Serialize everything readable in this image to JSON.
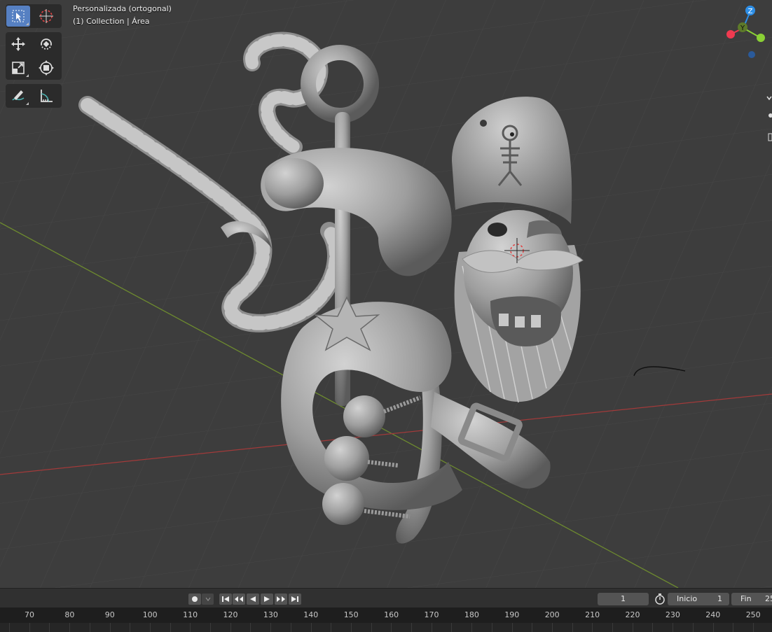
{
  "viewport": {
    "view_name": "Personalizada (ortogonal)",
    "collection_info": "(1) Collection | Área",
    "axis_labels": {
      "z": "Z",
      "y": "Y"
    },
    "colors": {
      "x_axis": "#f03a50",
      "y_axis": "#8ad035",
      "z_axis": "#2d8ee6",
      "grid_floor_x": "#a23a3a",
      "grid_floor_y": "#6d8a2f"
    }
  },
  "toolbar": {
    "tools": [
      "select-box-icon",
      "cursor-icon",
      "move-icon",
      "rotate-icon",
      "scale-icon",
      "transform-icon",
      "annotate-icon",
      "measure-icon"
    ],
    "active_tool": "select-box-icon"
  },
  "timeline": {
    "current_frame": "1",
    "start_label": "Inicio",
    "start_value": "1",
    "end_label": "Fin",
    "end_value": "25",
    "ruler_ticks": [
      "70",
      "80",
      "90",
      "100",
      "110",
      "120",
      "130",
      "140",
      "150",
      "160",
      "170",
      "180",
      "190",
      "200",
      "210",
      "220",
      "230",
      "240",
      "250"
    ]
  }
}
